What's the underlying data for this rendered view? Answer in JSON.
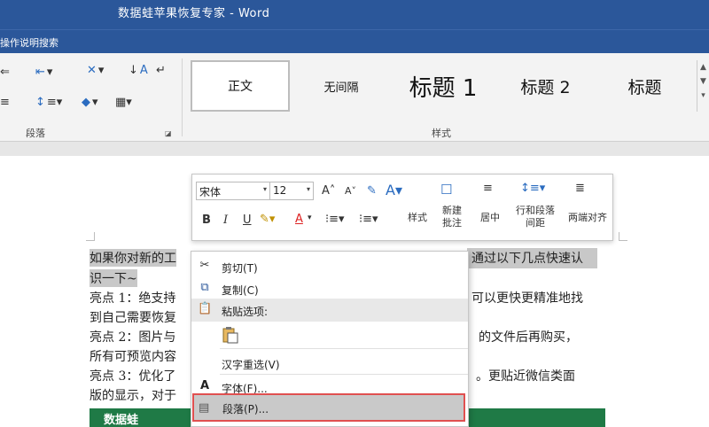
{
  "window": {
    "title": "数据蛙苹果恢复专家 - Word"
  },
  "tellme": {
    "label": "操作说明搜索"
  },
  "ribbon": {
    "paragraph_group": "段落",
    "styles_group": "样式",
    "styles": [
      {
        "label": "正文",
        "selected": true
      },
      {
        "label": "无间隔",
        "selected": false
      },
      {
        "label": "标题 1",
        "selected": false
      },
      {
        "label": "标题 2",
        "selected": false
      },
      {
        "label": "标题",
        "selected": false
      }
    ]
  },
  "mini_toolbar": {
    "font": "宋体",
    "size": "12",
    "grow_font": "A",
    "shrink_font": "A",
    "bold": "B",
    "italic": "I",
    "underline": "U",
    "font_color": "A",
    "styles_label": "样式",
    "new_comment_label": "新建批注",
    "center_label": "居中",
    "line_spacing_label": "行和段落间距",
    "justify_label": "两端对齐"
  },
  "document": {
    "lines": [
      "如果你对新的工",
      "识一下~",
      "亮点 1：绝支持",
      "到自己需要恢复",
      "亮点 2：图片与",
      "所有可预览内容",
      "亮点 3：优化了",
      "版的显示，对于"
    ],
    "right_fragments": [
      "通过以下几点快速认",
      "可以更快更精准地找",
      "的文件后再购买，",
      "。更贴近微信类面"
    ],
    "banner_text": "数据蛙"
  },
  "context_menu": {
    "items": [
      {
        "label": "剪切(T)",
        "icon": "scissors-icon"
      },
      {
        "label": "复制(C)",
        "icon": "copy-icon"
      },
      {
        "label": "粘贴选项:",
        "icon": "paste-icon"
      },
      {
        "label": "汉字重选(V)",
        "icon": ""
      },
      {
        "label": "字体(F)...",
        "icon": "font-icon"
      },
      {
        "label": "段落(P)...",
        "icon": "paragraph-icon"
      }
    ]
  }
}
